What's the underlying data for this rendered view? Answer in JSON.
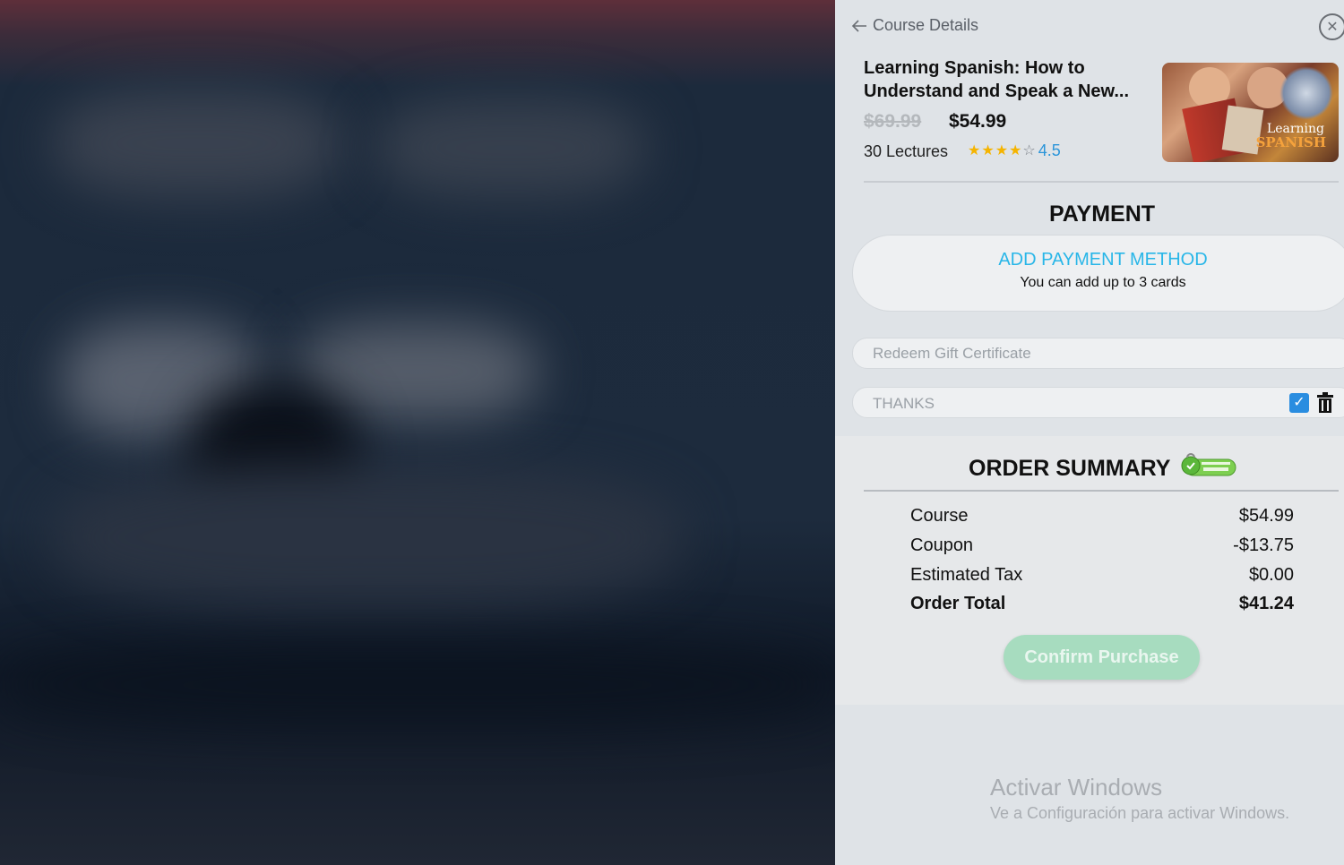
{
  "panel": {
    "back_label": "Course Details",
    "close_icon": "close-icon"
  },
  "course": {
    "title": "Learning Spanish: How to Understand and Speak a New...",
    "old_price": "$69.99",
    "new_price": "$54.99",
    "lectures": "30 Lectures",
    "rating": "4.5",
    "stars_filled": 4,
    "stars_total": 5,
    "thumb_text_1": "Learning",
    "thumb_text_2": "SPANISH"
  },
  "payment": {
    "title": "PAYMENT",
    "add_method": "ADD PAYMENT METHOD",
    "add_hint": "You can add up to 3 cards"
  },
  "gift": {
    "placeholder": "Redeem Gift Certificate"
  },
  "coupon": {
    "value": "THANKS",
    "checked": true
  },
  "summary": {
    "title": "ORDER SUMMARY",
    "rows": [
      {
        "label": "Course",
        "value": "$54.99"
      },
      {
        "label": "Coupon",
        "value": "-$13.75"
      },
      {
        "label": "Estimated Tax",
        "value": "$0.00"
      },
      {
        "label": "Order Total",
        "value": "$41.24"
      }
    ],
    "confirm_label": "Confirm Purchase"
  },
  "watermark": {
    "line1": "Activar Windows",
    "line2": "Ve a Configuración para activar Windows."
  },
  "colors": {
    "accent_blue": "#28b6e8",
    "star_gold": "#f5b400",
    "confirm_green": "#a7dcbf"
  }
}
